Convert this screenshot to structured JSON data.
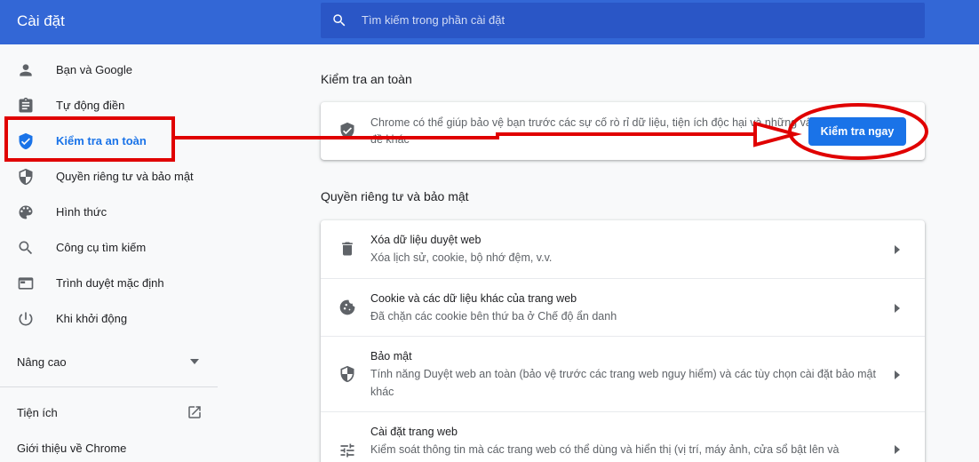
{
  "header": {
    "title": "Cài đặt",
    "search_placeholder": "Tìm kiếm trong phần cài đặt"
  },
  "sidebar": {
    "items": [
      {
        "label": "Bạn và Google",
        "icon": "person-icon"
      },
      {
        "label": "Tự động điền",
        "icon": "clipboard-icon"
      },
      {
        "label": "Kiểm tra an toàn",
        "icon": "shield-check-icon",
        "active": true
      },
      {
        "label": "Quyền riêng tư và bảo mật",
        "icon": "shield-icon"
      },
      {
        "label": "Hình thức",
        "icon": "palette-icon"
      },
      {
        "label": "Công cụ tìm kiếm",
        "icon": "search-icon"
      },
      {
        "label": "Trình duyệt mặc định",
        "icon": "browser-icon"
      },
      {
        "label": "Khi khởi động",
        "icon": "power-icon"
      }
    ],
    "advanced": "Nâng cao",
    "extensions": "Tiện ích",
    "about": "Giới thiệu về Chrome"
  },
  "safety_check": {
    "section_title": "Kiểm tra an toàn",
    "description": "Chrome có thể giúp bảo vệ bạn trước các sự cố rò rỉ dữ liệu, tiện ích độc hại và những vấn đề khác",
    "button": "Kiểm tra ngay"
  },
  "privacy": {
    "section_title": "Quyền riêng tư và bảo mật",
    "rows": [
      {
        "title": "Xóa dữ liệu duyệt web",
        "desc": "Xóa lịch sử, cookie, bộ nhớ đệm, v.v.",
        "icon": "trash-icon"
      },
      {
        "title": "Cookie và các dữ liệu khác của trang web",
        "desc": "Đã chặn các cookie bên thứ ba ở Chế độ ẩn danh",
        "icon": "cookie-icon"
      },
      {
        "title": "Bảo mật",
        "desc": "Tính năng Duyệt web an toàn (bảo vệ trước các trang web nguy hiểm) và các tùy chọn cài đặt bảo mật khác",
        "icon": "shield-icon"
      },
      {
        "title": "Cài đặt trang web",
        "desc": "Kiểm soát thông tin mà các trang web có thể dùng và hiển thị (vị trí, máy ảnh, cửa sổ bật lên và",
        "icon": "tune-icon"
      }
    ]
  },
  "colors": {
    "header": "#3367d6",
    "accent": "#1a73e8",
    "annotation": "#e00000"
  }
}
